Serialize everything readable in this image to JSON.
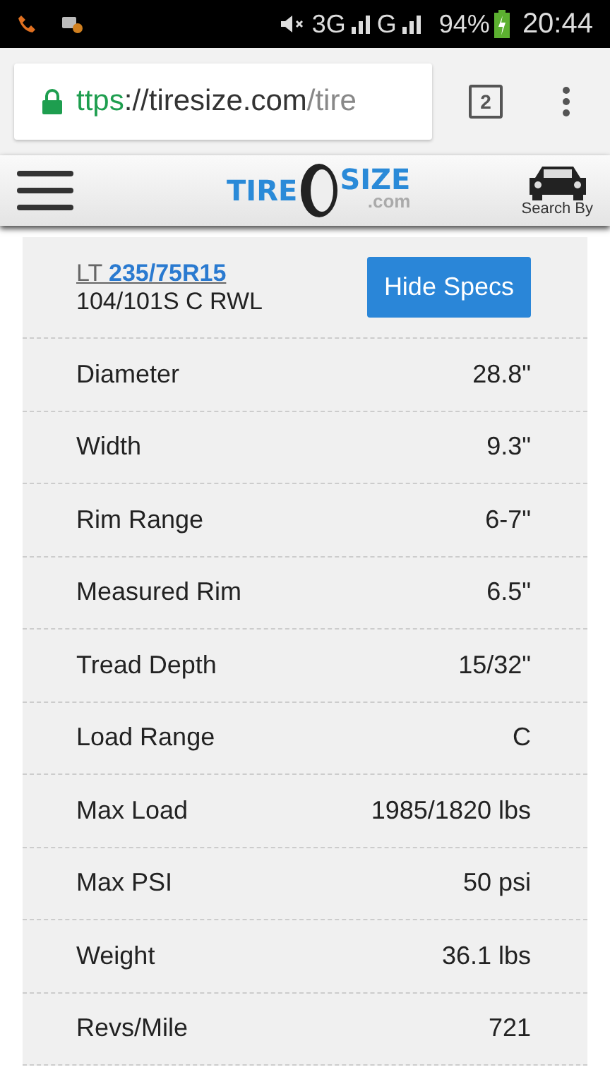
{
  "status_bar": {
    "network_1": "3G",
    "network_2": "G",
    "battery": "94%",
    "time": "20:44"
  },
  "browser": {
    "url_scheme": "ttps",
    "url_host": "://tiresize.com",
    "url_path": "/tire",
    "tab_count": "2"
  },
  "header": {
    "logo_left": "TIRE",
    "logo_right": "SIZE",
    "logo_domain": ".com",
    "search_by": "Search By"
  },
  "tire": {
    "size_link": "LT **235/75R15**",
    "service": "104/101S C RWL",
    "toggle_button": "Hide Specs"
  },
  "specs": [
    {
      "label": "Diameter",
      "value": "28.8\""
    },
    {
      "label": "Width",
      "value": "9.3\""
    },
    {
      "label": "Rim Range",
      "value": "6-7\""
    },
    {
      "label": "Measured Rim",
      "value": "6.5\""
    },
    {
      "label": "Tread Depth",
      "value": "15/32\""
    },
    {
      "label": "Load Range",
      "value": "C"
    },
    {
      "label": "Max Load",
      "value": "1985/1820 lbs"
    },
    {
      "label": "Max PSI",
      "value": "50 psi"
    },
    {
      "label": "Weight",
      "value": "36.1 lbs"
    },
    {
      "label": "Revs/Mile",
      "value": "721"
    }
  ]
}
